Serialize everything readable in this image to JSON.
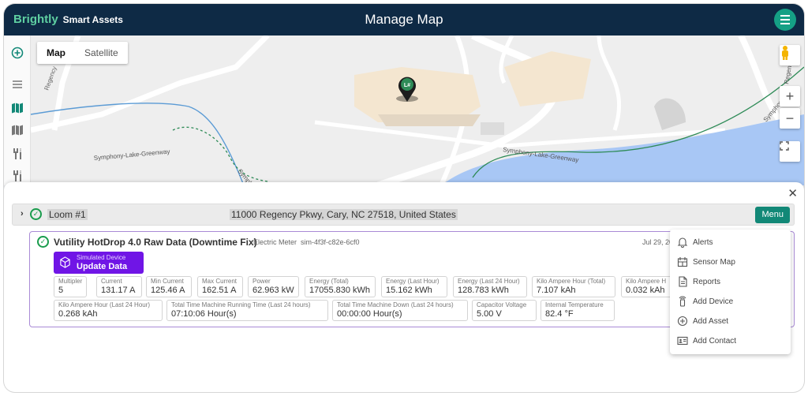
{
  "header": {
    "brand": "Brightly",
    "product": "Smart Assets",
    "title": "Manage Map"
  },
  "map": {
    "tabs": [
      {
        "label": "Map",
        "active": true
      },
      {
        "label": "Satellite",
        "active": false
      }
    ],
    "marker_label": "L#",
    "road_labels": {
      "regency": "Regency",
      "greenway_left": "Symphony-Lake-Greenway",
      "greenway_right": "Symphony-Lake-Greenway",
      "symph_short": "Symph",
      "symph_right": "Symphony",
      "regency_right": "Regency"
    },
    "colors": {
      "water": "#a8c7f5",
      "building": "#f4e6d0",
      "greenway": "#2e8b57",
      "stream": "#5b9bd5"
    }
  },
  "location": {
    "name": "Loom #1",
    "address": "11000 Regency Pkwy, Cary, NC 27518, United States",
    "menu_label": "Menu"
  },
  "device": {
    "title": "Vutility HotDrop 4.0 Raw Data (Downtime Fix)",
    "type": "Electric Meter",
    "id": "sim-4f3f-c82e-6cf0",
    "date": "Jul 29, 20",
    "sim_button": {
      "line1": "Simulated Device",
      "line2": "Update Data"
    },
    "metrics_row1": [
      {
        "label": "Multipler",
        "value": "5"
      },
      {
        "label": "Current",
        "value": "131.17 A"
      },
      {
        "label": "Min Current",
        "value": "125.46 A"
      },
      {
        "label": "Max Current",
        "value": "162.51 A"
      },
      {
        "label": "Power",
        "value": "62.963 kW"
      },
      {
        "label": "Energy (Total)",
        "value": "17055.830 kWh"
      },
      {
        "label": "Energy (Last Hour)",
        "value": "15.162 kWh"
      },
      {
        "label": "Energy (Last 24 Hour)",
        "value": "128.783 kWh"
      },
      {
        "label": "Kilo Ampere Hour (Total)",
        "value": "7.107 kAh"
      },
      {
        "label": "Kilo Ampere H",
        "value": "0.032 kAh"
      }
    ],
    "metrics_row2": [
      {
        "label": "Kilo Ampere Hour (Last 24 Hour)",
        "value": "0.268 kAh"
      },
      {
        "label": "Total Time Machine Running Time (Last 24 hours)",
        "value": "07:10:06 Hour(s)"
      },
      {
        "label": "Total Time Machine Down (Last 24 hours)",
        "value": "00:00:00 Hour(s)"
      },
      {
        "label": "Capacitor Voltage",
        "value": "5.00 V"
      },
      {
        "label": "Internal Temperature",
        "value": "82.4 °F"
      }
    ]
  },
  "dropdown": {
    "items": [
      {
        "label": "Alerts",
        "icon": "bell-icon"
      },
      {
        "label": "Sensor Map",
        "icon": "sensor-map-icon"
      },
      {
        "label": "Reports",
        "icon": "document-icon"
      },
      {
        "label": "Add Device",
        "icon": "device-icon"
      },
      {
        "label": "Add Asset",
        "icon": "plus-circle-icon"
      },
      {
        "label": "Add Contact",
        "icon": "contact-card-icon"
      }
    ]
  }
}
